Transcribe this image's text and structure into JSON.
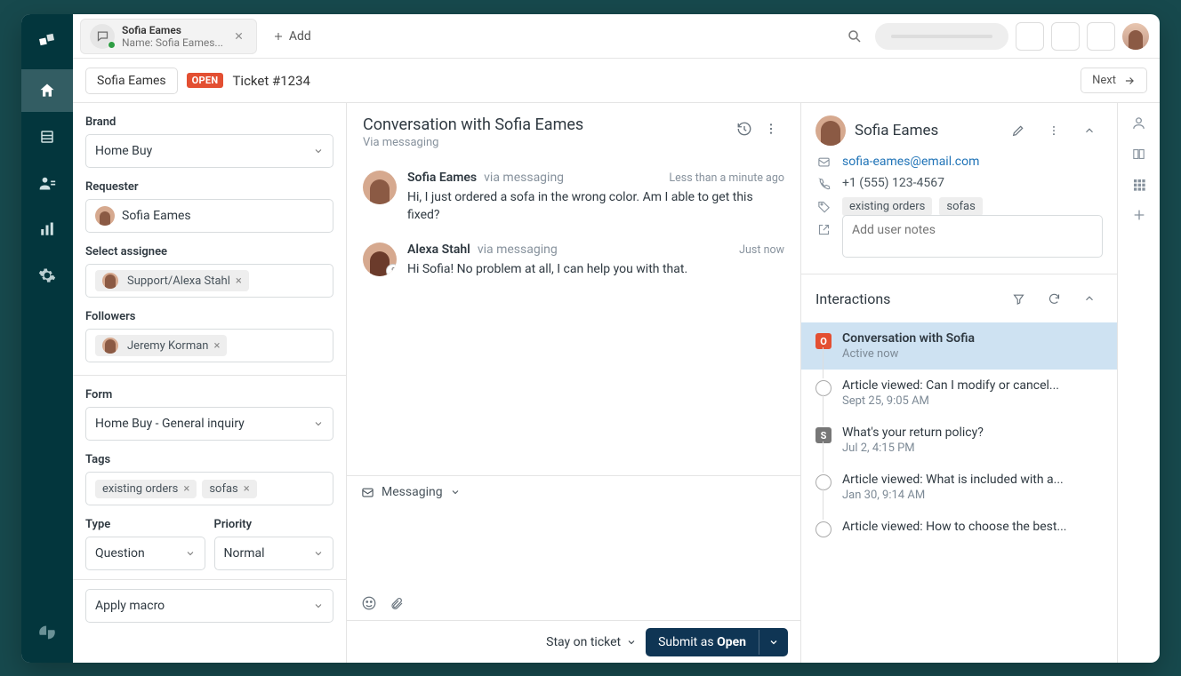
{
  "tab": {
    "title": "Sofia Eames",
    "subtitle": "Name: Sofia Eames...",
    "add": "Add"
  },
  "header": {
    "name": "Sofia Eames",
    "badge": "OPEN",
    "ticket": "Ticket #1234",
    "next": "Next"
  },
  "props": {
    "brand_label": "Brand",
    "brand_value": "Home Buy",
    "requester_label": "Requester",
    "requester_value": "Sofia Eames",
    "assignee_label": "Select assignee",
    "assignee_value": "Support/Alexa Stahl",
    "followers_label": "Followers",
    "follower_value": "Jeremy Korman",
    "form_label": "Form",
    "form_value": "Home Buy - General inquiry",
    "tags_label": "Tags",
    "tag1": "existing orders",
    "tag2": "sofas",
    "type_label": "Type",
    "type_value": "Question",
    "priority_label": "Priority",
    "priority_value": "Normal",
    "macro_label": "Apply macro"
  },
  "conv": {
    "title": "Conversation with Sofia Eames",
    "via": "Via messaging",
    "composer_channel": "Messaging",
    "m1": {
      "name": "Sofia Eames",
      "via": "via messaging",
      "time": "Less than a minute ago",
      "body": "Hi, I just ordered a sofa in the wrong color. Am I able to get this fixed?"
    },
    "m2": {
      "name": "Alexa Stahl",
      "via": "via messaging",
      "time": "Just now",
      "body": "Hi Sofia! No problem at all, I can help you with that."
    }
  },
  "context": {
    "name": "Sofia Eames",
    "email": "sofia-eames@email.com",
    "phone": "+1 (555) 123-4567",
    "tag1": "existing orders",
    "tag2": "sofas",
    "notes_placeholder": "Add user notes",
    "section": "Interactions",
    "items": [
      {
        "title": "Conversation with Sofia",
        "sub": "Active now"
      },
      {
        "title": "Article viewed: Can I modify or cancel...",
        "sub": "Sept 25, 9:05 AM"
      },
      {
        "title": "What's your return policy?",
        "sub": "Jul 2, 4:15 PM"
      },
      {
        "title": "Article viewed: What is included with a...",
        "sub": "Jan 30, 9:14 AM"
      },
      {
        "title": "Article viewed: How to choose the best...",
        "sub": ""
      }
    ]
  },
  "footer": {
    "stay": "Stay on ticket",
    "submit_prefix": "Submit as ",
    "submit_status": "Open"
  }
}
